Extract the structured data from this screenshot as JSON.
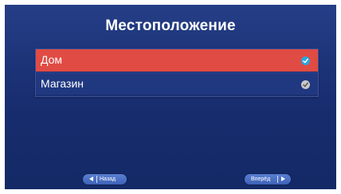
{
  "screen": {
    "title": "Местоположение"
  },
  "options": [
    {
      "label": "Дом",
      "selected": true
    },
    {
      "label": "Магазин",
      "selected": false
    }
  ],
  "nav": {
    "back_label": "Назад",
    "next_label": "Вперёд"
  },
  "icons": {
    "back": "arrow-left-icon",
    "next": "arrow-right-icon",
    "check": "checkmark-icon"
  },
  "colors": {
    "background": "#1d3479",
    "selected_row": "#e04b43",
    "normal_row": "#203880",
    "check_active": "#2aa7e0",
    "check_inactive": "#c9c9c9",
    "nav_button": "#4a6fc4"
  }
}
